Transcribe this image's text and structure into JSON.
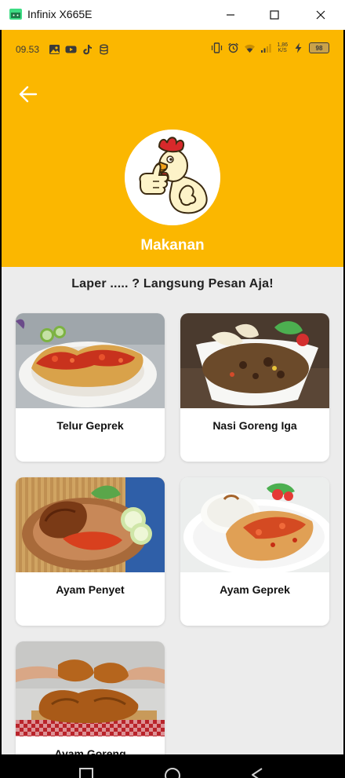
{
  "window": {
    "title": "Infinix X665E",
    "accent": "#3ddc84"
  },
  "status_bar": {
    "time": "09.53",
    "left_icons": [
      "gallery-icon",
      "youtube-icon",
      "tiktok-icon",
      "storage-icon"
    ],
    "right_icons": [
      "vibrate-icon",
      "alarm-icon",
      "wifi-icon",
      "signal-icon"
    ],
    "net_speed_value": "1,86",
    "net_speed_unit": "K/S",
    "battery": "98"
  },
  "header": {
    "back_icon": "arrow-left-icon",
    "title": "Makanan",
    "background": "#fbb700"
  },
  "subtitle": "Laper ..... ? Langsung Pesan Aja!",
  "menu_items": [
    {
      "name": "Telur Geprek",
      "photo": "telur-geprek-photo"
    },
    {
      "name": "Nasi Goreng Iga",
      "photo": "nasi-goreng-iga-photo"
    },
    {
      "name": "Ayam Penyet",
      "photo": "ayam-penyet-photo"
    },
    {
      "name": "Ayam Geprek",
      "photo": "ayam-geprek-photo"
    },
    {
      "name": "Ayam Goreng",
      "photo": "ayam-goreng-photo"
    }
  ],
  "nav_bar": [
    "recents-icon",
    "home-icon",
    "back-icon"
  ]
}
